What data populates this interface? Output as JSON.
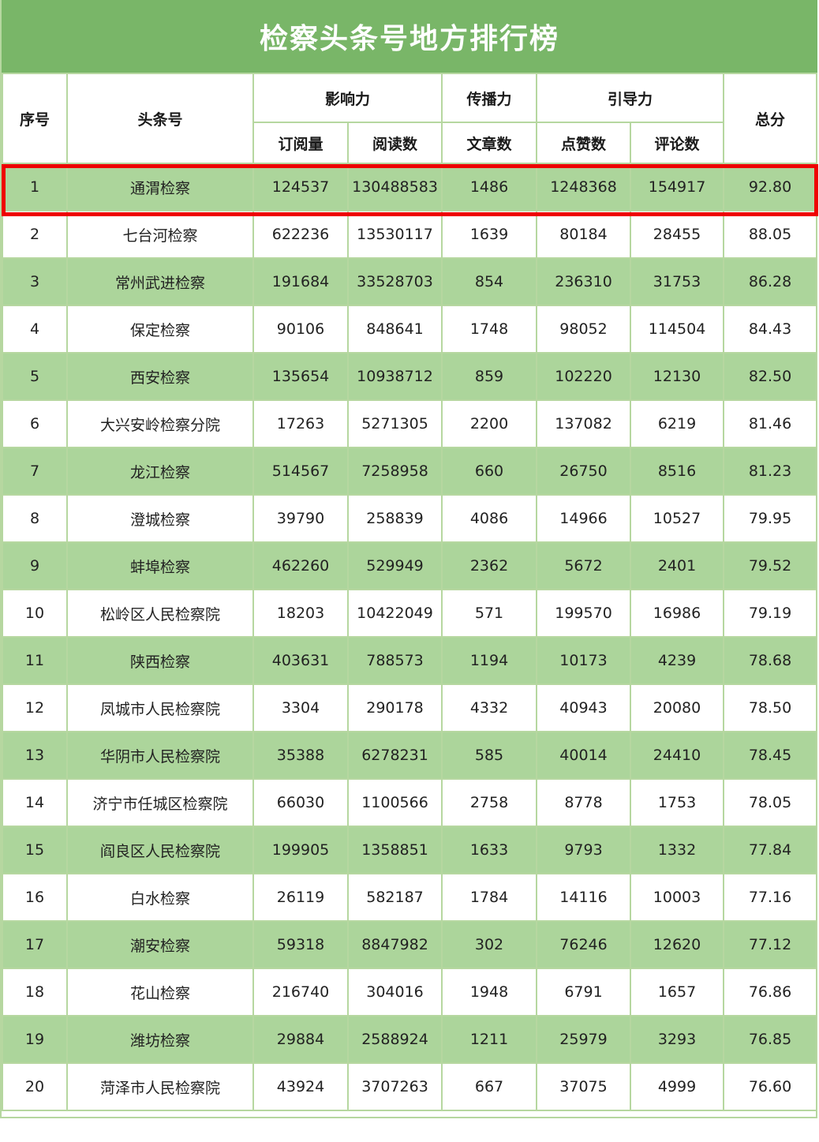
{
  "title": "检察头条号地方排行榜",
  "headers": {
    "rank": "序号",
    "account": "头条号",
    "influence": "影响力",
    "spread": "传播力",
    "guidance": "引导力",
    "total": "总分",
    "subscriptions": "订阅量",
    "reads": "阅读数",
    "articles": "文章数",
    "likes": "点赞数",
    "comments": "评论数"
  },
  "rows": [
    {
      "rank": "1",
      "name": "通渭检察",
      "subs": "124537",
      "reads": "130488583",
      "articles": "1486",
      "likes": "1248368",
      "comments": "154917",
      "total": "92.80"
    },
    {
      "rank": "2",
      "name": "七台河检察",
      "subs": "622236",
      "reads": "13530117",
      "articles": "1639",
      "likes": "80184",
      "comments": "28455",
      "total": "88.05"
    },
    {
      "rank": "3",
      "name": "常州武进检察",
      "subs": "191684",
      "reads": "33528703",
      "articles": "854",
      "likes": "236310",
      "comments": "31753",
      "total": "86.28"
    },
    {
      "rank": "4",
      "name": "保定检察",
      "subs": "90106",
      "reads": "848641",
      "articles": "1748",
      "likes": "98052",
      "comments": "114504",
      "total": "84.43"
    },
    {
      "rank": "5",
      "name": "西安检察",
      "subs": "135654",
      "reads": "10938712",
      "articles": "859",
      "likes": "102220",
      "comments": "12130",
      "total": "82.50"
    },
    {
      "rank": "6",
      "name": "大兴安岭检察分院",
      "subs": "17263",
      "reads": "5271305",
      "articles": "2200",
      "likes": "137082",
      "comments": "6219",
      "total": "81.46"
    },
    {
      "rank": "7",
      "name": "龙江检察",
      "subs": "514567",
      "reads": "7258958",
      "articles": "660",
      "likes": "26750",
      "comments": "8516",
      "total": "81.23"
    },
    {
      "rank": "8",
      "name": "澄城检察",
      "subs": "39790",
      "reads": "258839",
      "articles": "4086",
      "likes": "14966",
      "comments": "10527",
      "total": "79.95"
    },
    {
      "rank": "9",
      "name": "蚌埠检察",
      "subs": "462260",
      "reads": "529949",
      "articles": "2362",
      "likes": "5672",
      "comments": "2401",
      "total": "79.52"
    },
    {
      "rank": "10",
      "name": "松岭区人民检察院",
      "subs": "18203",
      "reads": "10422049",
      "articles": "571",
      "likes": "199570",
      "comments": "16986",
      "total": "79.19"
    },
    {
      "rank": "11",
      "name": "陕西检察",
      "subs": "403631",
      "reads": "788573",
      "articles": "1194",
      "likes": "10173",
      "comments": "4239",
      "total": "78.68"
    },
    {
      "rank": "12",
      "name": "凤城市人民检察院",
      "subs": "3304",
      "reads": "290178",
      "articles": "4332",
      "likes": "40943",
      "comments": "20080",
      "total": "78.50"
    },
    {
      "rank": "13",
      "name": "华阴市人民检察院",
      "subs": "35388",
      "reads": "6278231",
      "articles": "585",
      "likes": "40014",
      "comments": "24410",
      "total": "78.45"
    },
    {
      "rank": "14",
      "name": "济宁市任城区检察院",
      "subs": "66030",
      "reads": "1100566",
      "articles": "2758",
      "likes": "8778",
      "comments": "1753",
      "total": "78.05"
    },
    {
      "rank": "15",
      "name": "阎良区人民检察院",
      "subs": "199905",
      "reads": "1358851",
      "articles": "1633",
      "likes": "9793",
      "comments": "1332",
      "total": "77.84"
    },
    {
      "rank": "16",
      "name": "白水检察",
      "subs": "26119",
      "reads": "582187",
      "articles": "1784",
      "likes": "14116",
      "comments": "10003",
      "total": "77.16"
    },
    {
      "rank": "17",
      "name": "潮安检察",
      "subs": "59318",
      "reads": "8847982",
      "articles": "302",
      "likes": "76246",
      "comments": "12620",
      "total": "77.12"
    },
    {
      "rank": "18",
      "name": "花山检察",
      "subs": "216740",
      "reads": "304016",
      "articles": "1948",
      "likes": "6791",
      "comments": "1657",
      "total": "76.86"
    },
    {
      "rank": "19",
      "name": "潍坊检察",
      "subs": "29884",
      "reads": "2588924",
      "articles": "1211",
      "likes": "25979",
      "comments": "3293",
      "total": "76.85"
    },
    {
      "rank": "20",
      "name": "菏泽市人民检察院",
      "subs": "43924",
      "reads": "3707263",
      "articles": "667",
      "likes": "37075",
      "comments": "4999",
      "total": "76.60"
    }
  ],
  "colors": {
    "title_bg": "#79b668",
    "row_green": "#acd59b",
    "border": "#b6d7a0",
    "highlight": "#ee0000"
  }
}
